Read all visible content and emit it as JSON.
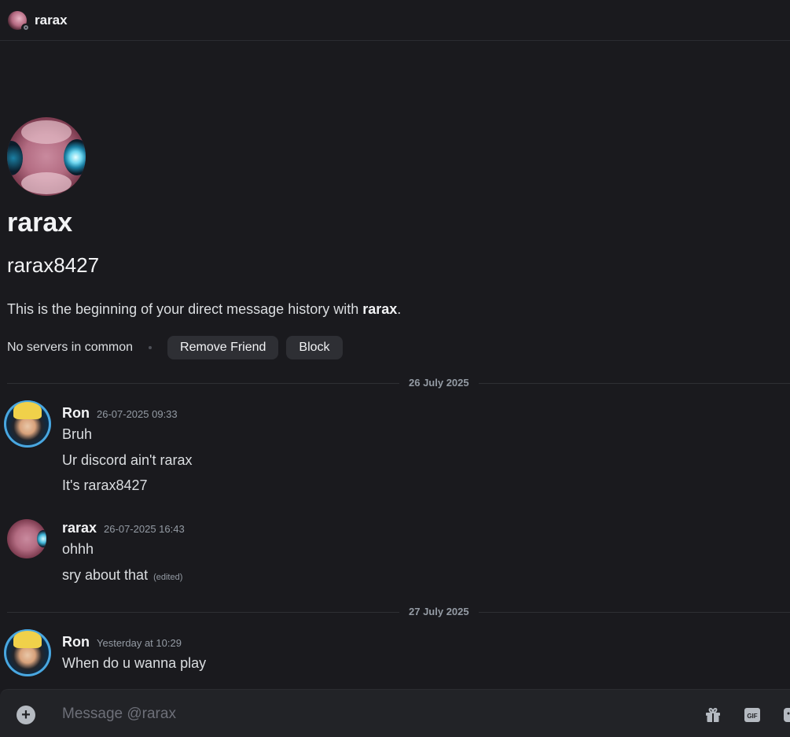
{
  "header": {
    "name": "rarax"
  },
  "profile": {
    "display_name": "rarax",
    "username": "rarax8427",
    "intro_prefix": "This is the beginning of your direct message history with ",
    "intro_name": "rarax",
    "intro_suffix": ".",
    "servers": "No servers in common",
    "remove_friend": "Remove Friend",
    "block": "Block"
  },
  "dividers": [
    "26 July 2025",
    "27 July 2025"
  ],
  "messages": [
    {
      "author": "Ron",
      "time": "26-07-2025 09:33",
      "lines": [
        "Bruh",
        "Ur discord ain't rarax",
        "It's rarax8427"
      ]
    },
    {
      "author": "rarax",
      "time": "26-07-2025 16:43",
      "lines": [
        "ohhh",
        "sry about that"
      ],
      "edited": "(edited)"
    },
    {
      "author": "Ron",
      "time": "Yesterday at 10:29",
      "lines": [
        "When do u wanna play"
      ]
    }
  ],
  "composer": {
    "placeholder": "Message @rarax"
  },
  "icons": [
    "add-attachment-icon",
    "gift-icon",
    "gif-icon",
    "sticker-icon"
  ]
}
